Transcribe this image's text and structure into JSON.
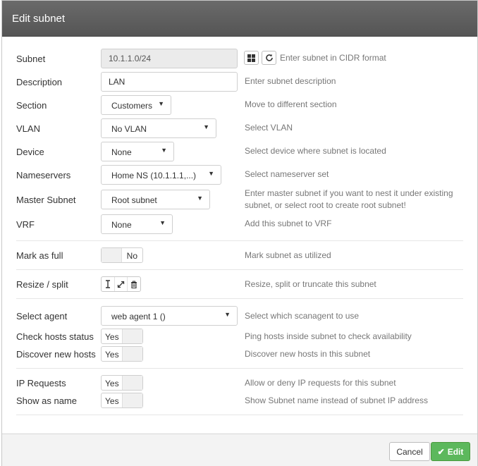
{
  "modal": {
    "title": "Edit subnet"
  },
  "fields": {
    "subnet": {
      "label": "Subnet",
      "value": "10.1.1.0/24",
      "help": "Enter subnet in CIDR format"
    },
    "description": {
      "label": "Description",
      "value": "LAN",
      "help": "Enter subnet description"
    },
    "section": {
      "label": "Section",
      "value": "Customers",
      "help": "Move to different section"
    },
    "vlan": {
      "label": "VLAN",
      "value": "No VLAN",
      "help": "Select VLAN"
    },
    "device": {
      "label": "Device",
      "value": "None",
      "help": "Select device where subnet is located"
    },
    "nameservers": {
      "label": "Nameservers",
      "value": "Home NS (10.1.1.1,...)",
      "help": "Select nameserver set"
    },
    "master_subnet": {
      "label": "Master Subnet",
      "value": "Root subnet",
      "help": "Enter master subnet if you want to nest it under existing subnet, or select root to create root subnet!"
    },
    "vrf": {
      "label": "VRF",
      "value": "None",
      "help": "Add this subnet to VRF"
    },
    "mark_full": {
      "label": "Mark as full",
      "state": "No",
      "help": "Mark subnet as utilized"
    },
    "resize": {
      "label": "Resize / split",
      "help": "Resize, split or truncate this subnet"
    },
    "agent": {
      "label": "Select agent",
      "value": "web agent 1 ()",
      "help": "Select which scanagent to use"
    },
    "check_hosts": {
      "label": "Check hosts status",
      "state": "Yes",
      "help": "Ping hosts inside subnet to check availability"
    },
    "discover_hosts": {
      "label": "Discover new hosts",
      "state": "Yes",
      "help": "Discover new hosts in this subnet"
    },
    "ip_requests": {
      "label": "IP Requests",
      "state": "Yes",
      "help": "Allow or deny IP requests for this subnet"
    },
    "show_name": {
      "label": "Show as name",
      "state": "Yes",
      "help": "Show Subnet name instead of subnet IP address"
    }
  },
  "icons": {
    "subnet_calc": "grid-icon",
    "subnet_refresh": "refresh-icon",
    "resize": "resize-vertical-icon",
    "split": "expand-icon",
    "truncate": "trash-icon",
    "edit_check": "check-icon"
  },
  "footer": {
    "cancel_label": "Cancel",
    "edit_label": "Edit"
  },
  "colors": {
    "header": "#5f5f5f",
    "primary": "#5cb85c",
    "help_text": "#777777"
  }
}
